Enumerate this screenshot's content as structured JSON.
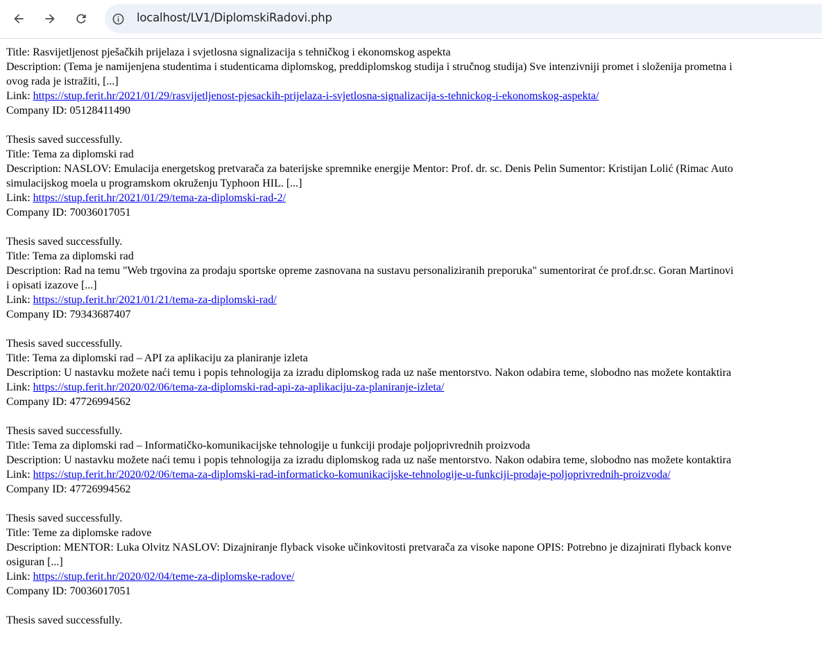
{
  "browser": {
    "url": "localhost/LV1/DiplomskiRadovi.php",
    "icons": {
      "back": "arrow-back-icon",
      "forward": "arrow-forward-icon",
      "reload": "reload-icon",
      "site_info": "info-circle-icon"
    },
    "colors": {
      "omnibox_bg": "#edf2fa",
      "link": "#0000ee"
    }
  },
  "labels": {
    "title": "Title:",
    "description": "Description:",
    "link": "Link:",
    "company": "Company ID:"
  },
  "status_message": "Thesis saved successfully.",
  "theses": [
    {
      "title": "Rasvijetljenost pješačkih prijelaza i svjetlosna signalizacija s tehničkog i ekonomskog aspekta",
      "description_line1": "(Tema je namijenjena studentima i studenticama diplomskog, preddiplomskog studija i stručnog studija) Sve intenzivniji promet i složenija prometna i",
      "description_line2": "ovog rada je istražiti, [...]",
      "link": "https://stup.ferit.hr/2021/01/29/rasvijetljenost-pjesackih-prijelaza-i-svjetlosna-signalizacija-s-tehnickog-i-ekonomskog-aspekta/",
      "company_id": "05128411490"
    },
    {
      "title": "Tema za diplomski rad",
      "description_line1": "NASLOV: Emulacija energetskog pretvarača za baterijske spremnike energije Mentor: Prof. dr. sc. Denis Pelin Sumentor: Kristijan Lolić (Rimac Auto",
      "description_line2": "simulacijskog moela u programskom okruženju Typhoon HIL. [...]",
      "link": "https://stup.ferit.hr/2021/01/29/tema-za-diplomski-rad-2/",
      "company_id": "70036017051"
    },
    {
      "title": "Tema za diplomski rad",
      "description_line1": "Rad na temu \"Web trgovina za prodaju sportske opreme zasnovana na sustavu personaliziranih preporuka\" sumentorirat će prof.dr.sc. Goran Martinovi",
      "description_line2": "i opisati izazove [...]",
      "link": "https://stup.ferit.hr/2021/01/21/tema-za-diplomski-rad/",
      "company_id": "79343687407"
    },
    {
      "title": "Tema za diplomski rad – API za aplikaciju za planiranje izleta",
      "description_line1": "U nastavku možete naći temu i popis tehnologija za izradu diplomskog rada uz naše mentorstvo. Nakon odabira teme, slobodno nas možete kontaktira",
      "description_line2": "",
      "link": "https://stup.ferit.hr/2020/02/06/tema-za-diplomski-rad-api-za-aplikaciju-za-planiranje-izleta/",
      "company_id": "47726994562"
    },
    {
      "title": "Tema za diplomski rad – Informatičko-komunikacijske tehnologije u funkciji prodaje poljoprivrednih proizvoda",
      "description_line1": "U nastavku možete naći temu i popis tehnologija za izradu diplomskog rada uz naše mentorstvo. Nakon odabira teme, slobodno nas možete kontaktira",
      "description_line2": "",
      "link": "https://stup.ferit.hr/2020/02/06/tema-za-diplomski-rad-informaticko-komunikacijske-tehnologije-u-funkciji-prodaje-poljoprivrednih-proizvoda/",
      "company_id": "47726994562"
    },
    {
      "title": "Teme za diplomske radove",
      "description_line1": "MENTOR: Luka Olvitz NASLOV: Dizajniranje flyback visoke učinkovitosti pretvarača za visoke napone OPIS: Potrebno je dizajnirati flyback konve",
      "description_line2": "osiguran [...]",
      "link": "https://stup.ferit.hr/2020/02/04/teme-za-diplomske-radove/",
      "company_id": "70036017051"
    }
  ]
}
